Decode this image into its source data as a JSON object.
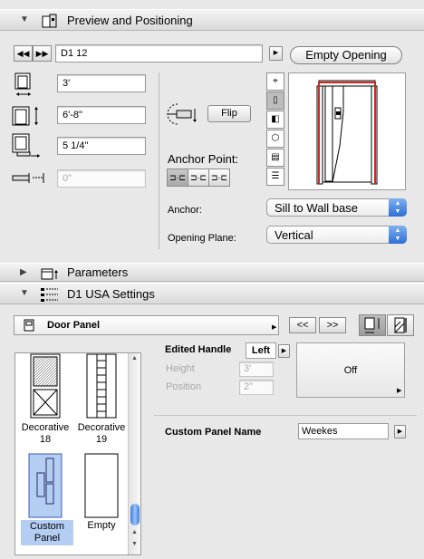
{
  "preview": {
    "title": "Preview and Positioning",
    "door_name": "D1 12",
    "empty_opening_label": "Empty Opening",
    "width_value": "3'",
    "height_value": "6'-8\"",
    "thickness_value": "5 1/4\"",
    "offset_value": "0\"",
    "flip_label": "Flip",
    "anchor_point_label": "Anchor Point:",
    "anchor_label": "Anchor:",
    "anchor_value": "Sill to Wall base",
    "opening_plane_label": "Opening Plane:",
    "opening_plane_value": "Vertical"
  },
  "parameters": {
    "title": "Parameters"
  },
  "settings": {
    "title": "D1 USA Settings",
    "panel_select": "Door Panel",
    "prev_label": "<<",
    "next_label": ">>",
    "edited_handle_label": "Edited Handle",
    "edited_handle_value": "Left",
    "height_label": "Height",
    "height_value": "3'",
    "position_label": "Position",
    "position_value": "2\"",
    "off_label": "Off",
    "custom_panel_name_label": "Custom Panel Name",
    "custom_panel_name_value": "Weekes",
    "panels": [
      {
        "label": "Decorative 18"
      },
      {
        "label": "Decorative 19"
      },
      {
        "label": "Custom Panel"
      },
      {
        "label": "Empty"
      }
    ]
  },
  "colors": {
    "selection": "#b4cdf2",
    "accent": "#2f6fd6",
    "preview_frame": "#d0281c"
  }
}
